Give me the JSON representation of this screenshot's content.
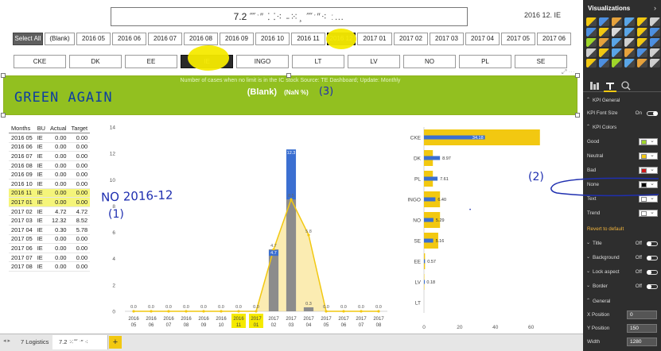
{
  "report": {
    "title_prefix": "7.2",
    "title_obscured": "⁗ˑ″ ⸬⁖ ˗⁙¸ ⁗ˑ″⁖ ː…",
    "selected_date": "2016 12. IE"
  },
  "month_slicer": {
    "items": [
      "Select All",
      "(Blank)",
      "2016 05",
      "2016 06",
      "2016 07",
      "2016 08",
      "2016 09",
      "2016 10",
      "2016 11",
      "2016 12",
      "2017 01",
      "2017 02",
      "2017 03",
      "2017 04",
      "2017 05",
      "2017 06"
    ],
    "selected": [
      "Select All",
      "2016 12"
    ]
  },
  "bu_slicer": {
    "items": [
      "CKE",
      "DK",
      "EE",
      "IE",
      "INGO",
      "LT",
      "LV",
      "NO",
      "PL",
      "SE"
    ],
    "selected": "IE"
  },
  "kpi_card": {
    "subtitle": "Number of cases when no limit is in the IC stock Source: TE Dashboard; Update: Monthly",
    "value": "(Blank)",
    "value_suffix": "(NaN %)",
    "annotation": "(3)"
  },
  "annotations": {
    "green_again": "GREEN AGAIN",
    "no_2016_12": "NO 2016-12",
    "label_1": "(1)",
    "label_2": "(2)"
  },
  "months_table": {
    "headers": [
      "Months",
      "BU",
      "Actual",
      "Target"
    ],
    "rows": [
      [
        "2016 05",
        "IE",
        "0.00",
        "0.00"
      ],
      [
        "2016 06",
        "IE",
        "0.00",
        "0.00"
      ],
      [
        "2016 07",
        "IE",
        "0.00",
        "0.00"
      ],
      [
        "2016 08",
        "IE",
        "0.00",
        "0.00"
      ],
      [
        "2016 09",
        "IE",
        "0.00",
        "0.00"
      ],
      [
        "2016 10",
        "IE",
        "0.00",
        "0.00"
      ],
      [
        "2016 11",
        "IE",
        "0.00",
        "0.00"
      ],
      [
        "2017 01",
        "IE",
        "0.00",
        "0.00"
      ],
      [
        "2017 02",
        "IE",
        "4.72",
        "4.72"
      ],
      [
        "2017 03",
        "IE",
        "12.32",
        "8.52"
      ],
      [
        "2017 04",
        "IE",
        "0.30",
        "5.78"
      ],
      [
        "2017 05",
        "IE",
        "0.00",
        "0.00"
      ],
      [
        "2017 06",
        "IE",
        "0.00",
        "0.00"
      ],
      [
        "2017 07",
        "IE",
        "0.00",
        "0.00"
      ],
      [
        "2017 08",
        "IE",
        "0.00",
        "0.00"
      ]
    ],
    "highlighted_rows": [
      6,
      7
    ]
  },
  "chart_data": [
    {
      "type": "bar",
      "categories": [
        "2016 05",
        "2016 06",
        "2016 07",
        "2016 08",
        "2016 09",
        "2016 10",
        "2016 11",
        "2017 01",
        "2017 02",
        "2017 03",
        "2017 04",
        "2017 05",
        "2017 06",
        "2017 07",
        "2017 08"
      ],
      "series": [
        {
          "values": [
            0,
            0,
            0,
            0,
            0,
            0,
            0,
            0,
            4.7,
            12.3,
            0.3,
            0,
            0,
            0,
            0
          ],
          "color": "#3b6fd1",
          "style": "bar-back"
        },
        {
          "values": [
            0,
            0,
            0,
            0,
            0,
            0,
            0,
            0,
            4.7,
            8.5,
            0.3,
            0,
            0,
            0,
            0
          ],
          "color": "#8c8c8c",
          "style": "bar-front"
        },
        {
          "values": [
            0,
            0,
            0,
            0,
            0,
            0,
            0,
            0,
            4.7,
            8.5,
            5.8,
            0,
            0,
            0,
            0
          ],
          "color": "#f2c811",
          "style": "area"
        }
      ],
      "point_labels": [
        "0.0",
        "0.0",
        "0.0",
        "0.0",
        "0.0",
        "0.0",
        "0.0",
        "0.0",
        "4.7",
        "12.3",
        "0.3",
        "0.0",
        "0.0",
        "0.0",
        "0.0"
      ],
      "extra_labels": {
        "2017 02": "4.7",
        "2017 03": "8.5",
        "2017 04": "5.8"
      },
      "yticks": [
        "0",
        "2",
        "4",
        "6",
        "8",
        "10",
        "12",
        "14"
      ],
      "ylim": [
        0,
        14
      ],
      "highlighted_categories": [
        "2016 11",
        "2017 01"
      ]
    },
    {
      "type": "bar",
      "orientation": "horizontal",
      "categories": [
        "CKE",
        "DK",
        "PL",
        "INGO",
        "NO",
        "SE",
        "EE",
        "LV",
        "LT"
      ],
      "series": [
        {
          "values": [
            65,
            5,
            5,
            9,
            9,
            8,
            0.6,
            0.2,
            0
          ],
          "color": "#f2c811"
        },
        {
          "values": [
            34.18,
            8.97,
            7.61,
            6.4,
            5.29,
            5.16,
            0.57,
            0.18,
            0
          ],
          "color": "#3b6fd1"
        }
      ],
      "value_labels": [
        "34.18",
        "8.97",
        "7.61",
        "6.40",
        "5.29",
        "5.16",
        "0.57",
        "0.18",
        ""
      ],
      "xticks": [
        "0",
        "20",
        "40",
        "60"
      ],
      "xlim": [
        0,
        70
      ]
    }
  ],
  "pane": {
    "title": "Visualizations",
    "sections": {
      "kpi_general": "KPI General",
      "kpi_font_size": "KPI Font Size",
      "kpi_font_size_value": "On",
      "kpi_colors": "KPI Colors",
      "good": "Good",
      "neutral": "Neutral",
      "bad": "Bad",
      "none": "None",
      "text": "Text",
      "trend": "Trend",
      "revert": "Revert to default",
      "title": "Title",
      "background": "Background",
      "lock_aspect": "Lock aspect",
      "border": "Border",
      "off": "Off",
      "general": "General",
      "x_position": "X Position",
      "x_value": "0",
      "y_position": "Y Position",
      "y_value": "150",
      "width": "Width",
      "width_value": "1280"
    },
    "colors": {
      "good": "#9fd62a",
      "neutral": "#f2c811",
      "bad": "#d11a1a",
      "none": "#000000",
      "text": "#ffffff",
      "trend": "#ffffff"
    }
  },
  "pages": {
    "tabs": [
      "7 Logistics",
      "7.2 ⁙⁗ ˑ″ ⁖"
    ],
    "active": 1,
    "add_label": "+"
  }
}
